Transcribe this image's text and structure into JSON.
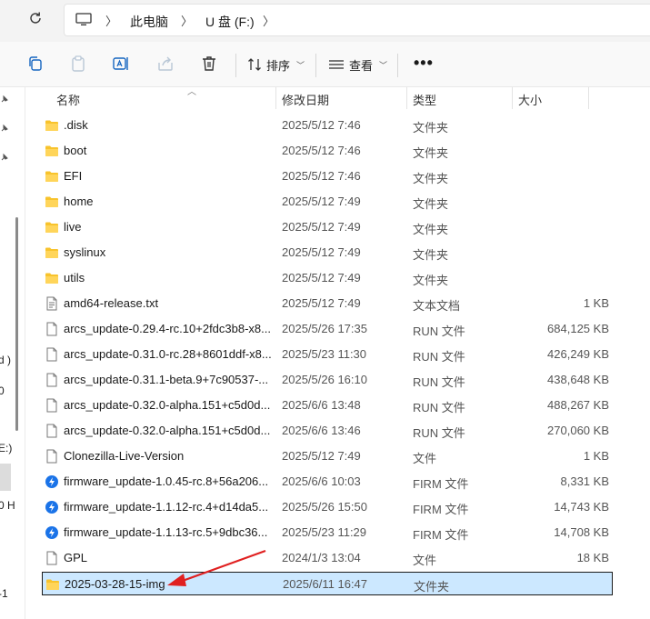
{
  "address": {
    "refresh_icon": "refresh-icon",
    "pc_icon": "computer-icon",
    "breadcrumbs": [
      "此电脑",
      "U 盘 (F:)"
    ]
  },
  "toolbar": {
    "icons": [
      "copy-icon",
      "paste-icon",
      "rename-icon",
      "share-icon",
      "delete-icon"
    ],
    "sort_label": "排序",
    "view_label": "查看",
    "more_label": "•••"
  },
  "nav_fragments": [
    "d )",
    "0",
    "E:)",
    "0 H",
    "-1"
  ],
  "columns": {
    "name": "名称",
    "date": "修改日期",
    "type": "类型",
    "size": "大小"
  },
  "files": [
    {
      "name": ".disk",
      "date": "2025/5/12 7:46",
      "type": "文件夹",
      "size": "",
      "icon": "folder"
    },
    {
      "name": "boot",
      "date": "2025/5/12 7:46",
      "type": "文件夹",
      "size": "",
      "icon": "folder"
    },
    {
      "name": "EFI",
      "date": "2025/5/12 7:46",
      "type": "文件夹",
      "size": "",
      "icon": "folder"
    },
    {
      "name": "home",
      "date": "2025/5/12 7:49",
      "type": "文件夹",
      "size": "",
      "icon": "folder"
    },
    {
      "name": "live",
      "date": "2025/5/12 7:49",
      "type": "文件夹",
      "size": "",
      "icon": "folder"
    },
    {
      "name": "syslinux",
      "date": "2025/5/12 7:49",
      "type": "文件夹",
      "size": "",
      "icon": "folder"
    },
    {
      "name": "utils",
      "date": "2025/5/12 7:49",
      "type": "文件夹",
      "size": "",
      "icon": "folder"
    },
    {
      "name": "amd64-release.txt",
      "date": "2025/5/12 7:49",
      "type": "文本文档",
      "size": "1 KB",
      "icon": "text"
    },
    {
      "name": "arcs_update-0.29.4-rc.10+2fdc3b8-x8...",
      "date": "2025/5/26 17:35",
      "type": "RUN 文件",
      "size": "684,125 KB",
      "icon": "file"
    },
    {
      "name": "arcs_update-0.31.0-rc.28+8601ddf-x8...",
      "date": "2025/5/23 11:30",
      "type": "RUN 文件",
      "size": "426,249 KB",
      "icon": "file"
    },
    {
      "name": "arcs_update-0.31.1-beta.9+7c90537-...",
      "date": "2025/5/26 16:10",
      "type": "RUN 文件",
      "size": "438,648 KB",
      "icon": "file"
    },
    {
      "name": "arcs_update-0.32.0-alpha.151+c5d0d...",
      "date": "2025/6/6 13:48",
      "type": "RUN 文件",
      "size": "488,267 KB",
      "icon": "file"
    },
    {
      "name": "arcs_update-0.32.0-alpha.151+c5d0d...",
      "date": "2025/6/6 13:46",
      "type": "RUN 文件",
      "size": "270,060 KB",
      "icon": "file"
    },
    {
      "name": "Clonezilla-Live-Version",
      "date": "2025/5/12 7:49",
      "type": "文件",
      "size": "1 KB",
      "icon": "file"
    },
    {
      "name": "firmware_update-1.0.45-rc.8+56a206...",
      "date": "2025/6/6 10:03",
      "type": "FIRM 文件",
      "size": "8,331 KB",
      "icon": "firm"
    },
    {
      "name": "firmware_update-1.1.12-rc.4+d14da5...",
      "date": "2025/5/26 15:50",
      "type": "FIRM 文件",
      "size": "14,743 KB",
      "icon": "firm"
    },
    {
      "name": "firmware_update-1.1.13-rc.5+9dbc36...",
      "date": "2025/5/23 11:29",
      "type": "FIRM 文件",
      "size": "14,708 KB",
      "icon": "firm"
    },
    {
      "name": "GPL",
      "date": "2024/1/3 13:04",
      "type": "文件",
      "size": "18 KB",
      "icon": "file"
    },
    {
      "name": "2025-03-28-15-img",
      "date": "2025/6/11 16:47",
      "type": "文件夹",
      "size": "",
      "icon": "folder",
      "selected": true
    }
  ],
  "colors": {
    "folder": "#f8c32c",
    "selection": "#cce8ff",
    "arrow": "#e02020",
    "firm": "#1a73e8"
  }
}
